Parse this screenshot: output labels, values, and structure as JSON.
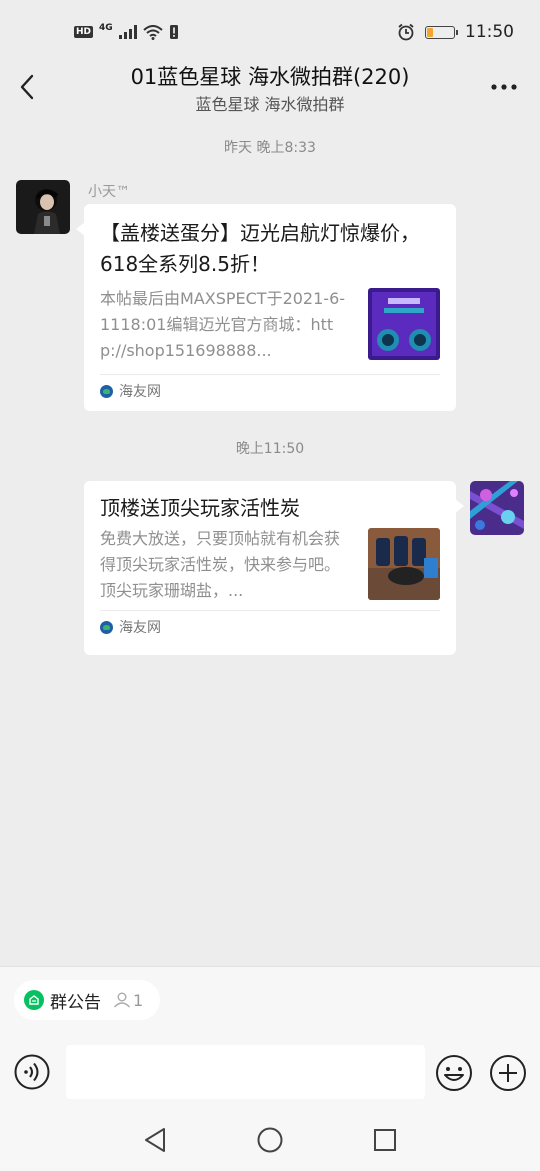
{
  "status_bar": {
    "hd": "HD",
    "network": "4G",
    "time": "11:50",
    "battery_level": 0.25,
    "battery_color": "#f3a531"
  },
  "header": {
    "back_icon": "chevron-left-icon",
    "title": "01蓝色星球 海水微拍群(220)",
    "subtitle": "蓝色星球 海水微拍群",
    "more_icon": "more-dots-icon"
  },
  "messages": [
    {
      "time_label": "昨天 晚上8:33",
      "sender": "小天™",
      "side": "left",
      "card": {
        "title": "【盖楼送蛋分】迈光启航灯惊爆价，618全系列8.5折！",
        "description": "本帖最后由MAXSPECT于2021-6-1118:01编辑迈光官方商城：http://shop151698888...",
        "source": "海友网"
      }
    },
    {
      "time_label": "晚上11:50",
      "side": "right",
      "card": {
        "title": "顶楼送顶尖玩家活性炭",
        "description": "免费大放送，只要顶帖就有机会获得顶尖玩家活性炭，快来参与吧。顶尖玩家珊瑚盐，...",
        "source": "海友网"
      }
    }
  ],
  "bottom": {
    "notice_label": "群公告",
    "notice_count": "1",
    "input_placeholder": "",
    "voice_icon": "voice-icon",
    "emoji_icon": "emoji-icon",
    "plus_icon": "plus-icon"
  },
  "system_nav": {
    "back_icon": "triangle-back-icon",
    "home_icon": "circle-home-icon",
    "recent_icon": "square-recent-icon"
  },
  "colors": {
    "background": "#ededed",
    "accent_green": "#07c160",
    "card_bg": "#ffffff"
  }
}
